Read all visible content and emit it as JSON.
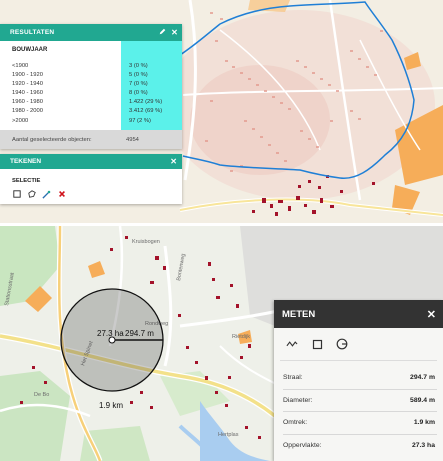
{
  "resultaten": {
    "title": "RESULTATEN",
    "section_title": "BOUWJAAR",
    "rows": [
      {
        "label": "<1900",
        "value": "3 (0 %)"
      },
      {
        "label": "1900 - 1920",
        "value": "5 (0 %)"
      },
      {
        "label": "1920 - 1940",
        "value": "7 (0 %)"
      },
      {
        "label": "1940 - 1960",
        "value": "8 (0 %)"
      },
      {
        "label": "1960 - 1980",
        "value": "1.422 (29 %)"
      },
      {
        "label": "1980 - 2000",
        "value": "3.412 (69 %)"
      },
      {
        "label": ">2000",
        "value": "97 (2 %)"
      }
    ],
    "footer_label": "Aantal geselecteerde objecten:",
    "footer_count": "4954"
  },
  "tekenen": {
    "title": "TEKENEN",
    "selectie_label": "SELECTIE"
  },
  "meten": {
    "title": "METEN",
    "rows": [
      {
        "label": "Straal:",
        "value": "294.7 m"
      },
      {
        "label": "Diameter:",
        "value": "589.4 m"
      },
      {
        "label": "Omtrek:",
        "value": "1.9 km"
      },
      {
        "label": "Oppervlakte:",
        "value": "27.3 ha"
      }
    ]
  },
  "map": {
    "circle_area_label": "27.3 ha",
    "circle_radius_label": "294.7 m",
    "circumference_label": "1.9 km",
    "street_labels": [
      "Kruisbogen",
      "Rondweg",
      "Rietdijk",
      "Het Spinet",
      "De Bo",
      "Stationsstraat",
      "Bontenweg",
      "Hertplas"
    ]
  },
  "colors": {
    "teal_header": "#21a891",
    "cyan_values": "#5bf1ea",
    "meten_header": "#333333",
    "boundary_blue": "#1f7fd6",
    "building_dark_red": "#a3122a"
  }
}
